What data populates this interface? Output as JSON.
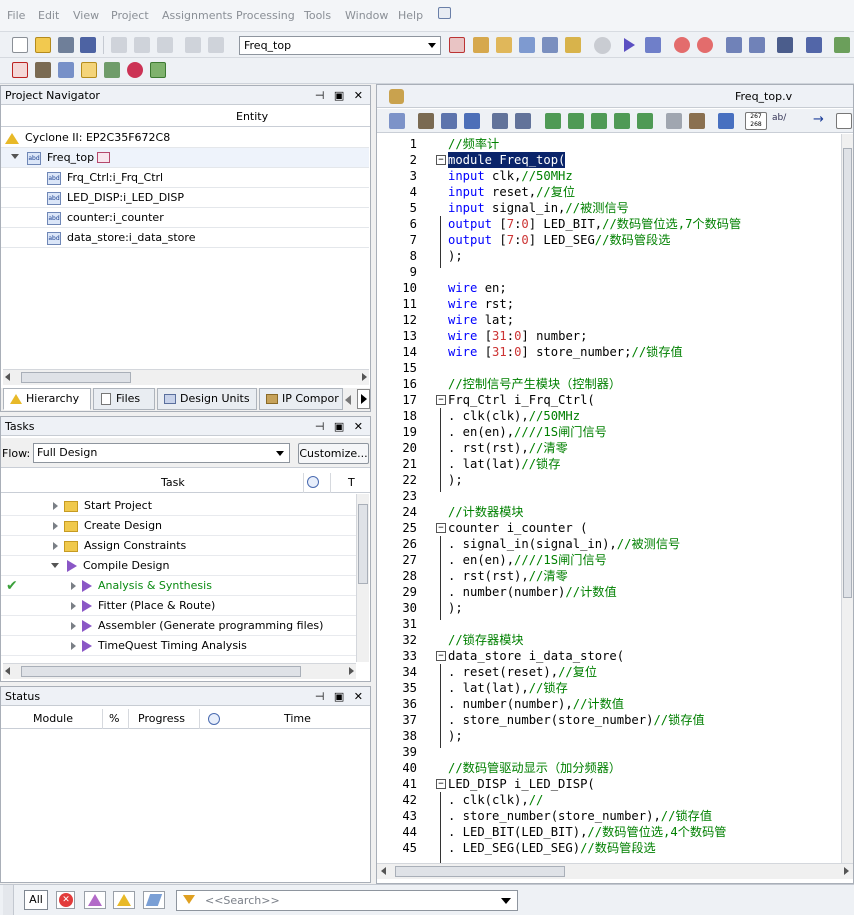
{
  "menu": [
    "File",
    "Edit",
    "View",
    "Project",
    "Assignments",
    "Processing",
    "Tools",
    "Window",
    "Help"
  ],
  "toolbar": {
    "entity_select": "Freq_top"
  },
  "navigator": {
    "title": "Project Navigator",
    "entity_header": "Entity",
    "device": "Cyclone II: EP2C35F672C8",
    "top": "Freq_top",
    "children": [
      "Frq_Ctrl:i_Frq_Ctrl",
      "LED_DISP:i_LED_DISP",
      "counter:i_counter",
      "data_store:i_data_store"
    ],
    "tabs": [
      "Hierarchy",
      "Files",
      "Design Units",
      "IP Compor"
    ]
  },
  "tasks": {
    "title": "Tasks",
    "flow_label": "Flow:",
    "flow_value": "Full Design",
    "customize": "Customize...",
    "col_task": "Task",
    "col_t": "T",
    "items": [
      {
        "label": "Start Project",
        "type": "folder"
      },
      {
        "label": "Create Design",
        "type": "folder"
      },
      {
        "label": "Assign Constraints",
        "type": "folder"
      },
      {
        "label": "Compile Design",
        "type": "play"
      },
      {
        "label": "Analysis & Synthesis",
        "type": "play"
      },
      {
        "label": "Fitter (Place & Route)",
        "type": "play"
      },
      {
        "label": "Assembler (Generate programming files)",
        "type": "play"
      },
      {
        "label": "TimeQuest Timing Analysis",
        "type": "play"
      }
    ]
  },
  "status": {
    "title": "Status",
    "cols": [
      "Module",
      "%",
      "Progress",
      "Time"
    ]
  },
  "editor": {
    "file": "Freq_top.v",
    "lines": [
      "//频率计",
      "module Freq_top(",
      "input clk,//50MHz",
      "input reset,//复位",
      "input signal_in,//被测信号",
      "output [7:0] LED_BIT,//数码管位选,7个数码管",
      "output [7:0] LED_SEG//数码管段选",
      ");",
      "",
      "wire en;",
      "wire rst;",
      "wire lat;",
      "wire [31:0] number;",
      "wire [31:0] store_number;//锁存值",
      "",
      "//控制信号产生模块（控制器）",
      "Frq_Ctrl i_Frq_Ctrl(",
      ". clk(clk),//50MHz",
      ". en(en),////1S闸门信号",
      ". rst(rst),//清零",
      ". lat(lat)//锁存",
      ");",
      "",
      "//计数器模块",
      "counter i_counter (",
      ". signal_in(signal_in),//被测信号",
      ". en(en),////1S闸门信号",
      ". rst(rst),//清零",
      ". number(number)//计数值",
      ");",
      "",
      "//锁存器模块",
      "data_store i_data_store(",
      ". reset(reset),//复位",
      ". lat(lat),//锁存",
      ". number(number),//计数值",
      ". store_number(store_number)//锁存值",
      ");",
      "",
      "//数码管驱动显示（加分频器）",
      "LED_DISP i_LED_DISP(",
      ". clk(clk),//",
      ". store_number(store_number),//锁存值",
      ". LED_BIT(LED_BIT),//数码管位选,4个数码管",
      ". LED_SEG(LED_SEG)//数码管段选"
    ]
  },
  "messages": {
    "all": "All",
    "search_placeholder": "<<Search>>"
  }
}
